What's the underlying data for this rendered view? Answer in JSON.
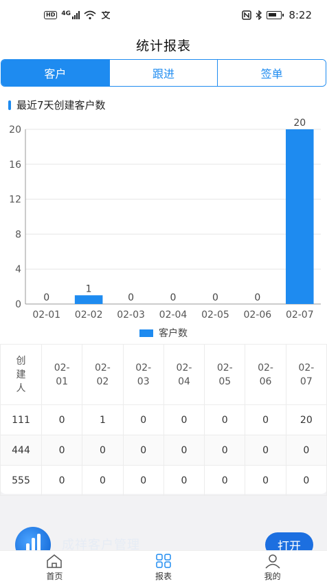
{
  "status_bar": {
    "hd": "HD",
    "network": "4G",
    "time": "8:22",
    "icons": [
      "hd-icon",
      "signal-icon",
      "wifi-icon",
      "translate-icon",
      "nfc-icon",
      "bluetooth-icon",
      "battery-icon"
    ]
  },
  "header": {
    "title": "统计报表"
  },
  "tabs": [
    {
      "label": "客户",
      "active": true
    },
    {
      "label": "跟进",
      "active": false
    },
    {
      "label": "签单",
      "active": false
    }
  ],
  "section": {
    "title": "最近7天创建客户数"
  },
  "chart_data": {
    "type": "bar",
    "categories": [
      "02-01",
      "02-02",
      "02-03",
      "02-04",
      "02-05",
      "02-06",
      "02-07"
    ],
    "series": [
      {
        "name": "客户数",
        "values": [
          0,
          1,
          0,
          0,
          0,
          0,
          20
        ]
      }
    ],
    "ylim": [
      0,
      20
    ],
    "yticks": [
      0,
      4,
      8,
      12,
      16,
      20
    ],
    "grid": true,
    "legend": "bottom",
    "color": "#1e8bf0"
  },
  "table": {
    "headers": [
      "创建人",
      "02-01",
      "02-02",
      "02-03",
      "02-04",
      "02-05",
      "02-06",
      "02-07"
    ],
    "rows": [
      [
        "111",
        "0",
        "1",
        "0",
        "0",
        "0",
        "0",
        "20"
      ],
      [
        "444",
        "0",
        "0",
        "0",
        "0",
        "0",
        "0",
        "0"
      ],
      [
        "555",
        "0",
        "0",
        "0",
        "0",
        "0",
        "0",
        "0"
      ]
    ]
  },
  "banner": {
    "app_name": "成祥客户管理",
    "open_label": "打开"
  },
  "bottom_nav": [
    {
      "label": "首页",
      "icon": "home-icon"
    },
    {
      "label": "报表",
      "icon": "grid-icon"
    },
    {
      "label": "我的",
      "icon": "user-icon"
    }
  ],
  "colors": {
    "accent": "#1e8bf0",
    "banner_button": "#1c6fe0"
  }
}
